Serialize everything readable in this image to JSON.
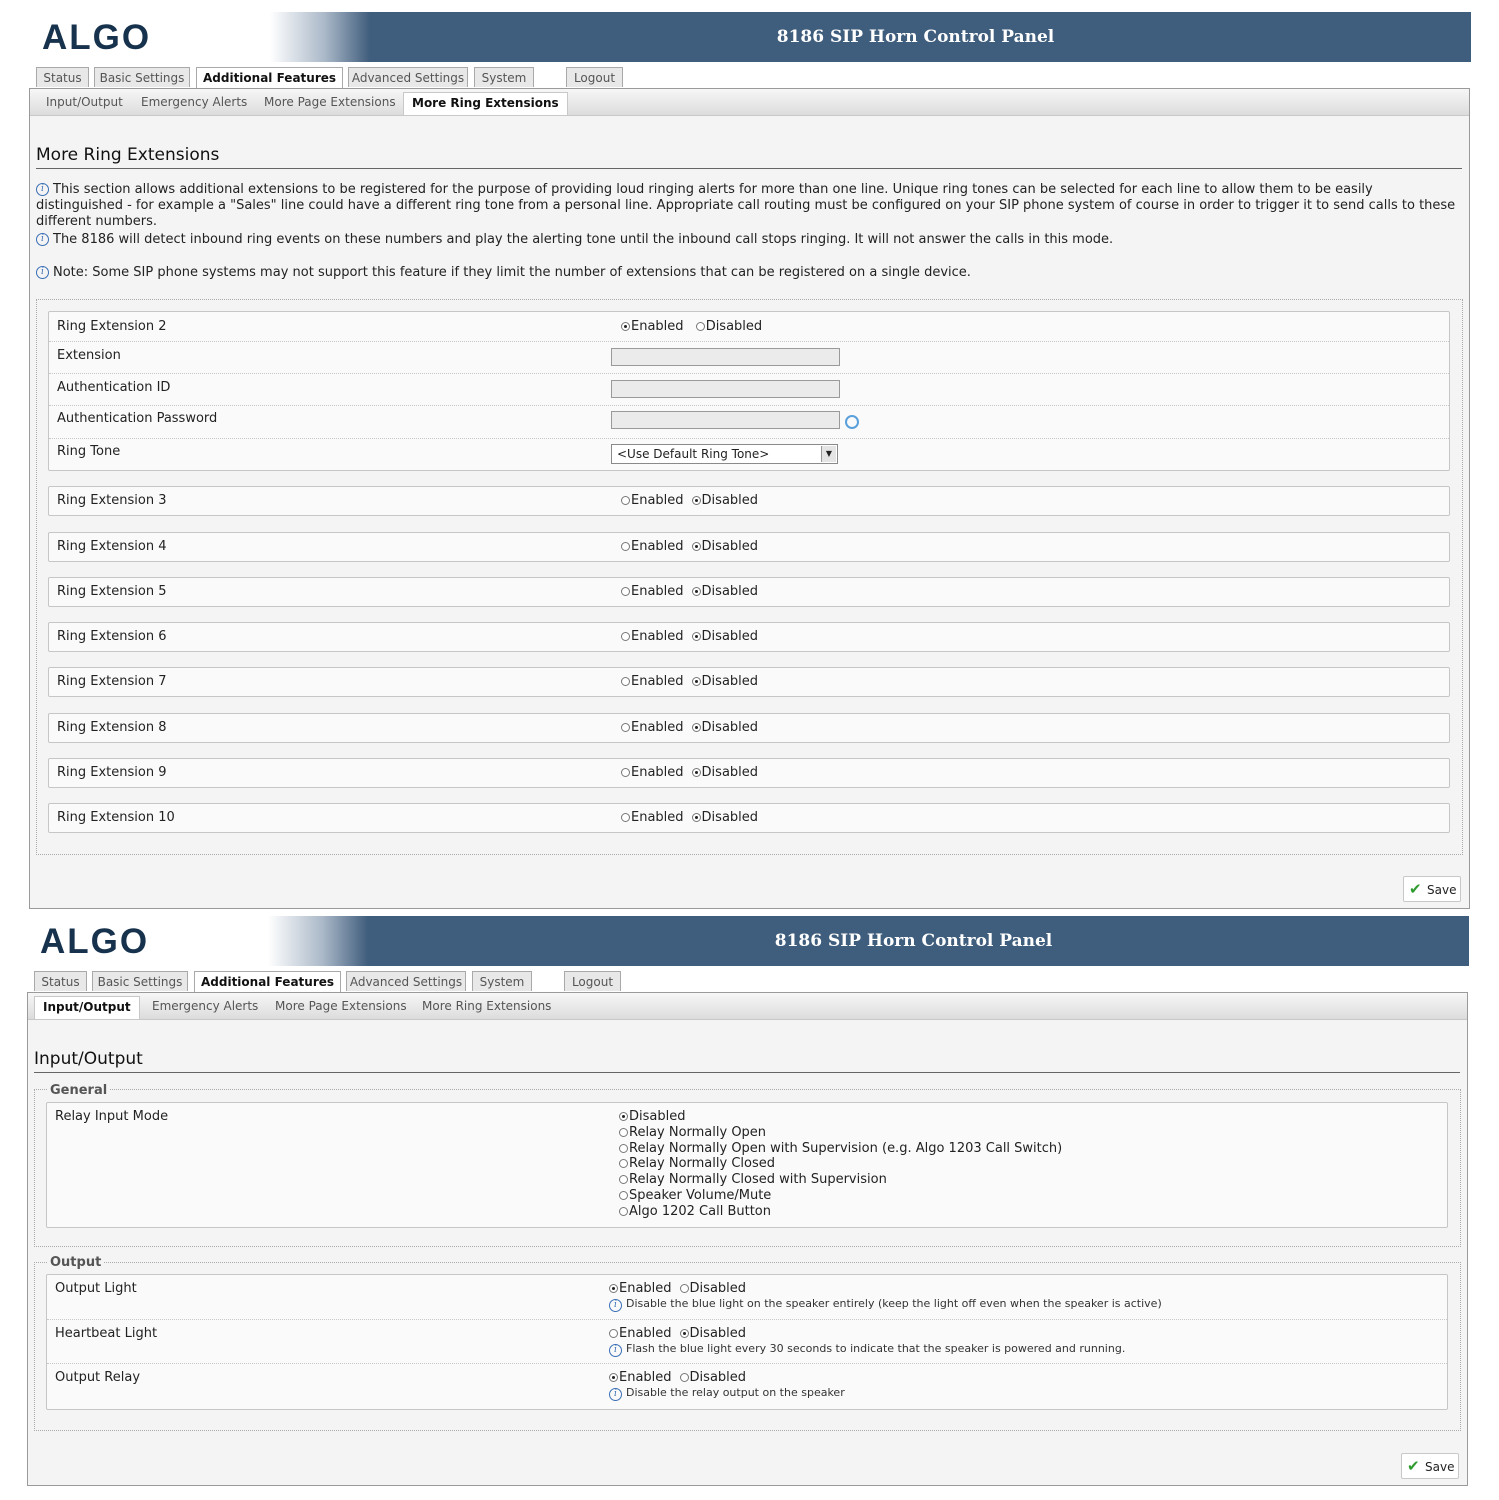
{
  "panels": [
    {
      "logo": "ALGO",
      "title": "8186 SIP Horn Control Panel",
      "tabs": [
        "Status",
        "Basic Settings",
        "Additional Features",
        "Advanced Settings",
        "System",
        "Logout"
      ],
      "active_tab": "Additional Features",
      "subtabs": [
        "Input/Output",
        "Emergency Alerts",
        "More Page Extensions",
        "More Ring Extensions"
      ],
      "active_subtab": "More Ring Extensions",
      "section_title": "More Ring Extensions",
      "info": [
        "This section allows additional extensions to be registered for the purpose of providing loud ringing alerts for more than one line. Unique ring tones can be selected for each line to allow them to be easily distinguished - for example a \"Sales\" line could have a different ring tone from a personal line. Appropriate call routing must be configured on your SIP phone system of course in order to trigger it to send calls to these different numbers.",
        "The 8186 will detect inbound ring events on these numbers and play the alerting tone until the inbound call stops ringing. It will not answer the calls in this mode.",
        "Note: Some SIP phone systems may not support this feature if they limit the number of extensions that can be registered on a single device."
      ],
      "ring_ext2": {
        "label": "Ring Extension 2",
        "state": "Enabled",
        "extension_label": "Extension",
        "extension_value": "",
        "auth_id_label": "Authentication ID",
        "auth_id_value": "",
        "auth_pw_label": "Authentication Password",
        "auth_pw_value": "",
        "ring_tone_label": "Ring Tone",
        "ring_tone_value": "<Use Default Ring Tone>"
      },
      "ring_extensions": [
        {
          "label": "Ring Extension 3",
          "state": "Disabled"
        },
        {
          "label": "Ring Extension 4",
          "state": "Disabled"
        },
        {
          "label": "Ring Extension 5",
          "state": "Disabled"
        },
        {
          "label": "Ring Extension 6",
          "state": "Disabled"
        },
        {
          "label": "Ring Extension 7",
          "state": "Disabled"
        },
        {
          "label": "Ring Extension 8",
          "state": "Disabled"
        },
        {
          "label": "Ring Extension 9",
          "state": "Disabled"
        },
        {
          "label": "Ring Extension 10",
          "state": "Disabled"
        }
      ],
      "enabled_label": "Enabled",
      "disabled_label": "Disabled",
      "save_label": "Save"
    },
    {
      "logo": "ALGO",
      "title": "8186 SIP Horn Control Panel",
      "tabs": [
        "Status",
        "Basic Settings",
        "Additional Features",
        "Advanced Settings",
        "System",
        "Logout"
      ],
      "active_tab": "Additional Features",
      "subtabs": [
        "Input/Output",
        "Emergency Alerts",
        "More Page Extensions",
        "More Ring Extensions"
      ],
      "active_subtab": "Input/Output",
      "section_title": "Input/Output",
      "general_legend": "General",
      "relay_input_label": "Relay Input Mode",
      "relay_input_options": [
        "Disabled",
        "Relay Normally Open",
        "Relay Normally Open with Supervision (e.g. Algo 1203 Call Switch)",
        "Relay Normally Closed",
        "Relay Normally Closed with Supervision",
        "Speaker Volume/Mute",
        "Algo 1202 Call Button"
      ],
      "relay_input_selected": "Disabled",
      "output_legend": "Output",
      "outputs": [
        {
          "label": "Output Light",
          "state": "Enabled",
          "note": "Disable the blue light on the speaker entirely (keep the light off even when the speaker is active)"
        },
        {
          "label": "Heartbeat Light",
          "state": "Disabled",
          "note": "Flash the blue light every 30 seconds to indicate that the speaker is powered and running."
        },
        {
          "label": "Output Relay",
          "state": "Enabled",
          "note": "Disable the relay output on the speaker"
        }
      ],
      "enabled_label": "Enabled",
      "disabled_label": "Disabled",
      "save_label": "Save"
    }
  ],
  "colors": {
    "header_bar": "#3f5d7c",
    "logo": "#17324d",
    "save_check": "#2e9b2e",
    "info_icon": "#3a6fb5"
  }
}
